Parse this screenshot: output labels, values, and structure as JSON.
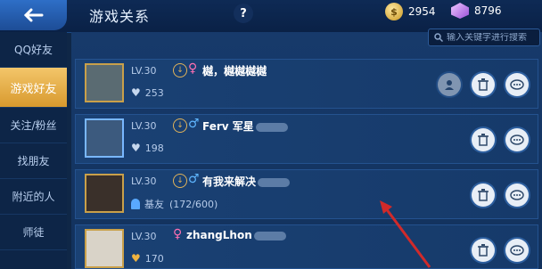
{
  "header": {
    "title": "游戏关系",
    "help_label": "?",
    "coins": "2954",
    "gems": "8796"
  },
  "search": {
    "placeholder": "输入关键字进行搜索"
  },
  "sidebar": {
    "items": [
      {
        "label": "QQ好友"
      },
      {
        "label": "游戏好友"
      },
      {
        "label": "关注/粉丝"
      },
      {
        "label": "找朋友"
      },
      {
        "label": "附近的人"
      },
      {
        "label": "师徒"
      }
    ]
  },
  "friends": [
    {
      "level": "LV.30",
      "name": "樾，樾樾樾樾",
      "stat_value": "253"
    },
    {
      "level": "LV.30",
      "name": "Ferv 军星",
      "stat_value": "198"
    },
    {
      "level": "LV.30",
      "name": "有我来解决",
      "stat_label": "基友",
      "stat_value": "(172/600)"
    },
    {
      "level": "LV.30",
      "name": "zhangLhon",
      "stat_value": "170"
    }
  ],
  "colors": {
    "accent": "#e0a93b",
    "background": "#12315c",
    "annotation_arrow": "#d12a2a"
  }
}
